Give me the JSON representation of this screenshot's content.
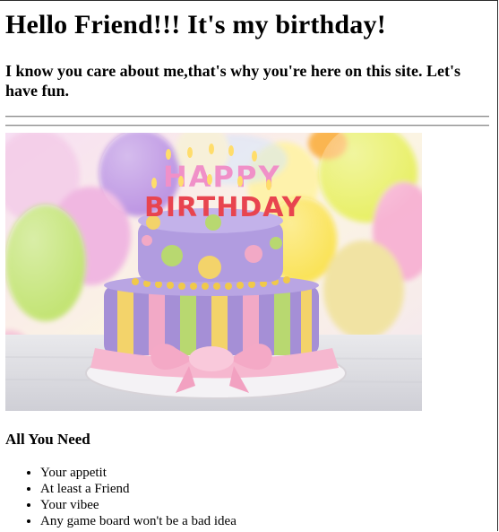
{
  "header": {
    "title": "Hello Friend!!! It's my birthday!",
    "subtitle": "I know you care about me,that's why you're here on this site. Let's have fun."
  },
  "image": {
    "subject": "birthday-cake-with-balloons",
    "cake_text_top": "HAPPY",
    "cake_text_bottom": "BIRTHDAY",
    "colors": {
      "cake_purple": "#a58fd6",
      "stripe_yellow": "#f3d36a",
      "stripe_green": "#b8d870",
      "stripe_pink": "#f2a9c6",
      "ribbon_pink": "#f6b7cf",
      "balloon_yellow": "#e7ef5c",
      "balloon_purple": "#b88ee2",
      "balloon_green": "#bfe36b"
    }
  },
  "section": {
    "heading": "All You Need",
    "items": [
      "Your appetit",
      "At least a Friend",
      "Your vibee",
      "Any game board won't be a bad idea"
    ]
  }
}
